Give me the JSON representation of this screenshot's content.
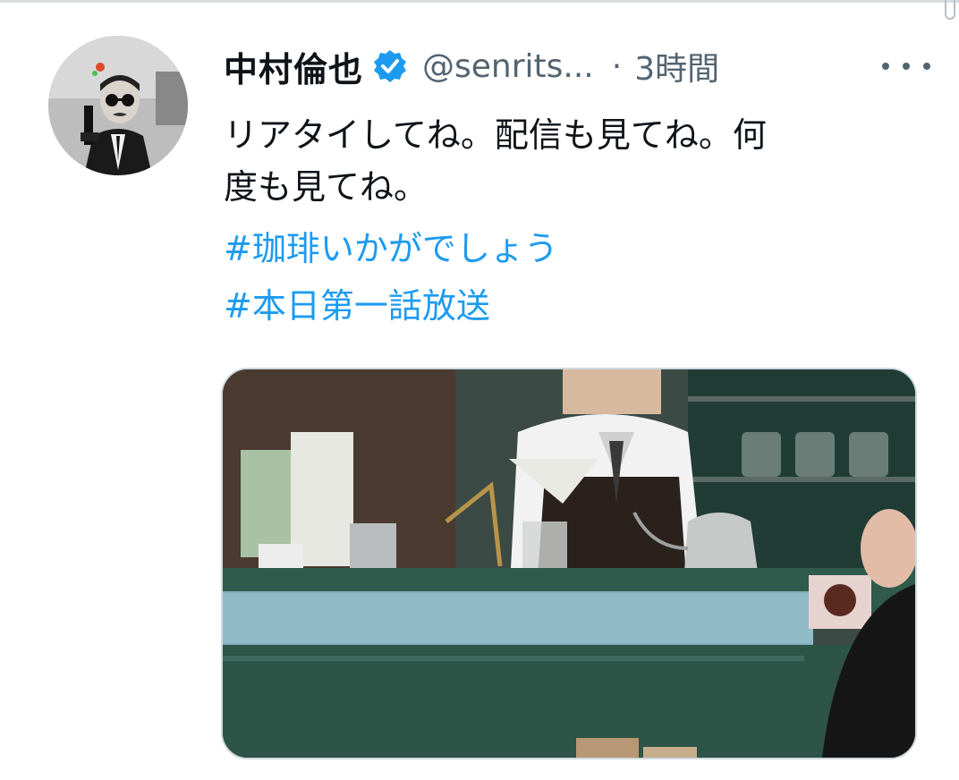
{
  "tweet": {
    "display_name": "中村倫也",
    "handle": "@senrits...",
    "separator": "·",
    "timestamp": "3時間",
    "verified": true,
    "text_lines": [
      "リアタイしてね。配信も見てね。何",
      "度も見てね。"
    ],
    "hashtags": [
      "#珈琲いかがでしょう",
      "#本日第一話放送"
    ]
  },
  "icons": {
    "verified": "verified-badge-icon",
    "more": "more-horizontal-icon"
  },
  "colors": {
    "link": "#1d9bf0",
    "secondary_text": "#536471",
    "verified_badge": "#1d9bf0",
    "counter_green": "#2f5a4c"
  }
}
